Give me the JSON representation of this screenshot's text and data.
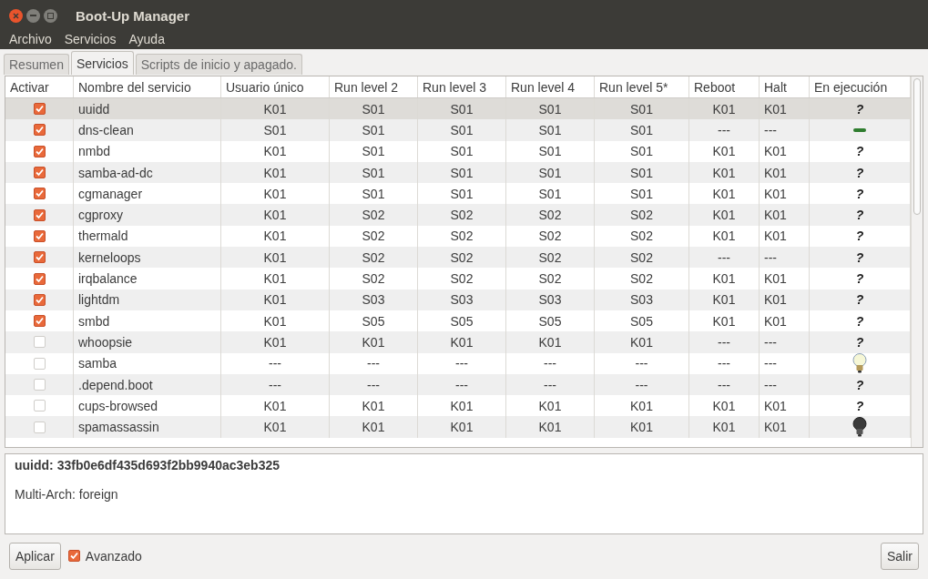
{
  "window": {
    "title": "Boot-Up Manager"
  },
  "menu": [
    "Archivo",
    "Servicios",
    "Ayuda"
  ],
  "tabs": [
    {
      "label": "Resumen",
      "selected": false
    },
    {
      "label": "Servicios",
      "selected": true
    },
    {
      "label": "Scripts de inicio y apagado.",
      "selected": false
    }
  ],
  "table": {
    "columns": [
      "Activar",
      "Nombre del servicio",
      "Usuario único",
      "Run level 2",
      "Run level 3",
      "Run level 4",
      "Run level 5*",
      "Reboot",
      "Halt",
      "En ejecución"
    ],
    "rows": [
      {
        "checked": true,
        "selected": true,
        "cells": [
          "",
          "uuidd",
          "K01",
          "S01",
          "S01",
          "S01",
          "S01",
          "K01",
          "K01"
        ],
        "running": {
          "kind": "text",
          "text": "?"
        }
      },
      {
        "checked": true,
        "selected": false,
        "cells": [
          "",
          "dns-clean",
          "S01",
          "S01",
          "S01",
          "S01",
          "S01",
          "---",
          "---"
        ],
        "running": {
          "kind": "dash"
        }
      },
      {
        "checked": true,
        "selected": false,
        "cells": [
          "",
          "nmbd",
          "K01",
          "S01",
          "S01",
          "S01",
          "S01",
          "K01",
          "K01"
        ],
        "running": {
          "kind": "text",
          "text": "?"
        }
      },
      {
        "checked": true,
        "selected": false,
        "cells": [
          "",
          "samba-ad-dc",
          "K01",
          "S01",
          "S01",
          "S01",
          "S01",
          "K01",
          "K01"
        ],
        "running": {
          "kind": "text",
          "text": "?"
        }
      },
      {
        "checked": true,
        "selected": false,
        "cells": [
          "",
          "cgmanager",
          "K01",
          "S01",
          "S01",
          "S01",
          "S01",
          "K01",
          "K01"
        ],
        "running": {
          "kind": "text",
          "text": "?"
        }
      },
      {
        "checked": true,
        "selected": false,
        "cells": [
          "",
          "cgproxy",
          "K01",
          "S02",
          "S02",
          "S02",
          "S02",
          "K01",
          "K01"
        ],
        "running": {
          "kind": "text",
          "text": "?"
        }
      },
      {
        "checked": true,
        "selected": false,
        "cells": [
          "",
          "thermald",
          "K01",
          "S02",
          "S02",
          "S02",
          "S02",
          "K01",
          "K01"
        ],
        "running": {
          "kind": "text",
          "text": "?"
        }
      },
      {
        "checked": true,
        "selected": false,
        "cells": [
          "",
          "kerneloops",
          "K01",
          "S02",
          "S02",
          "S02",
          "S02",
          "---",
          "---"
        ],
        "running": {
          "kind": "text",
          "text": "?"
        }
      },
      {
        "checked": true,
        "selected": false,
        "cells": [
          "",
          "irqbalance",
          "K01",
          "S02",
          "S02",
          "S02",
          "S02",
          "K01",
          "K01"
        ],
        "running": {
          "kind": "text",
          "text": "?"
        }
      },
      {
        "checked": true,
        "selected": false,
        "cells": [
          "",
          "lightdm",
          "K01",
          "S03",
          "S03",
          "S03",
          "S03",
          "K01",
          "K01"
        ],
        "running": {
          "kind": "text",
          "text": "?"
        }
      },
      {
        "checked": true,
        "selected": false,
        "cells": [
          "",
          "smbd",
          "K01",
          "S05",
          "S05",
          "S05",
          "S05",
          "K01",
          "K01"
        ],
        "running": {
          "kind": "text",
          "text": "?"
        }
      },
      {
        "checked": false,
        "selected": false,
        "cells": [
          "",
          "whoopsie",
          "K01",
          "K01",
          "K01",
          "K01",
          "K01",
          "---",
          "---"
        ],
        "running": {
          "kind": "text",
          "text": "?"
        }
      },
      {
        "checked": false,
        "selected": false,
        "cells": [
          "",
          "samba",
          "---",
          "---",
          "---",
          "---",
          "---",
          "---",
          "---"
        ],
        "running": {
          "kind": "bulb-on"
        }
      },
      {
        "checked": false,
        "selected": false,
        "cells": [
          "",
          ".depend.boot",
          "---",
          "---",
          "---",
          "---",
          "---",
          "---",
          "---"
        ],
        "running": {
          "kind": "text",
          "text": "?"
        }
      },
      {
        "checked": false,
        "selected": false,
        "cells": [
          "",
          "cups-browsed",
          "K01",
          "K01",
          "K01",
          "K01",
          "K01",
          "K01",
          "K01"
        ],
        "running": {
          "kind": "text",
          "text": "?"
        }
      },
      {
        "checked": false,
        "selected": false,
        "cells": [
          "",
          "spamassassin",
          "K01",
          "K01",
          "K01",
          "K01",
          "K01",
          "K01",
          "K01"
        ],
        "running": {
          "kind": "bulb-off"
        }
      }
    ]
  },
  "details": {
    "title": "uuidd:  33fb0e6df435d693f2bb9940ac3eb325",
    "text": "Multi-Arch: foreign"
  },
  "footer": {
    "apply": "Aplicar",
    "advanced": {
      "label": "Avanzado",
      "checked": true
    },
    "quit": "Salir"
  }
}
